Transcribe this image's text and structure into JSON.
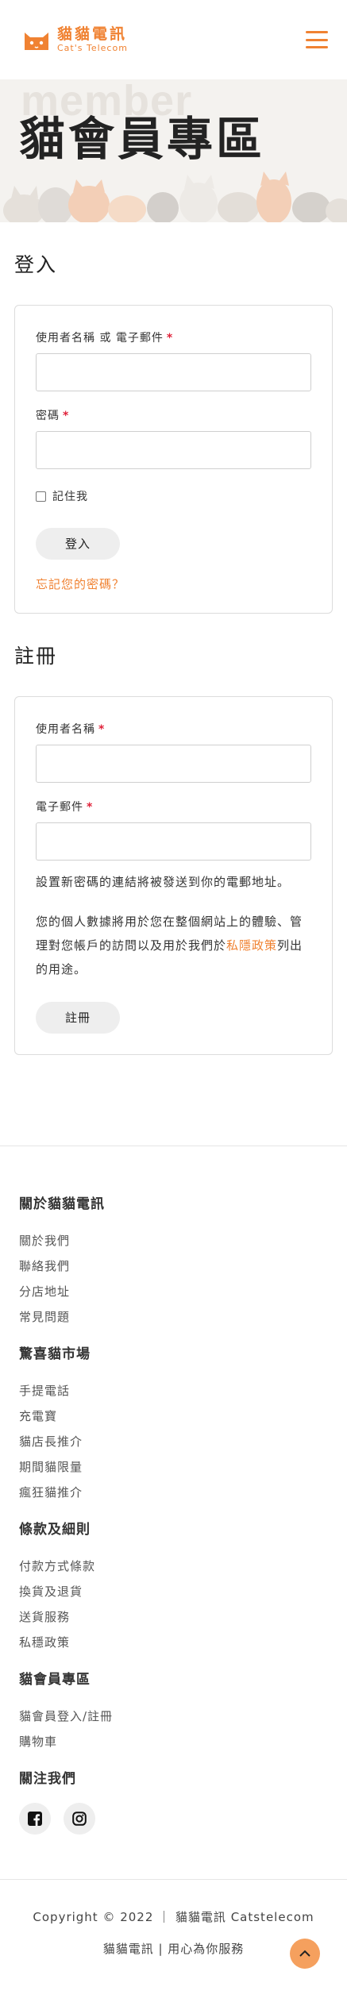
{
  "header": {
    "logo_cn": "貓貓電訊",
    "logo_en": "Cat's Telecom"
  },
  "hero": {
    "subtitle": "member",
    "title": "貓會員專區"
  },
  "login": {
    "heading": "登入",
    "username_label": "使用者名稱 或 電子郵件",
    "password_label": "密碼",
    "required_mark": "*",
    "remember_label": "記住我",
    "submit_label": "登入",
    "forgot_link": "忘記您的密碼？"
  },
  "register": {
    "heading": "註冊",
    "username_label": "使用者名稱",
    "email_label": "電子郵件",
    "required_mark": "*",
    "password_note": "設置新密碼的連結將被發送到你的電郵地址。",
    "privacy_before": "您的個人數據將用於您在整個網站上的體驗、管理對您帳戶的訪問以及用於我們於",
    "privacy_link": "私隱政策",
    "privacy_after": "列出的用途。",
    "submit_label": "註冊"
  },
  "footer": {
    "groups": [
      {
        "heading": "關於貓貓電訊",
        "items": [
          "關於我們",
          "聯絡我們",
          "分店地址",
          "常見問題"
        ]
      },
      {
        "heading": "驚喜貓市場",
        "items": [
          "手提電話",
          "充電寶",
          "貓店長推介",
          "期間貓限量",
          "瘋狂貓推介"
        ]
      },
      {
        "heading": "條款及細則",
        "items": [
          "付款方式條款",
          "換貨及退貨",
          "送貨服務",
          "私穩政策"
        ]
      },
      {
        "heading": "貓會員專區",
        "items": [
          "貓會員登入/註冊",
          "購物車"
        ]
      }
    ],
    "follow_heading": "關注我們",
    "social_icons": [
      "facebook-icon",
      "instagram-icon"
    ],
    "copyright": "Copyright © 2022 ｜ 貓貓電訊 Catstelecom",
    "slogan": "貓貓電訊 | 用心為你服務"
  },
  "colors": {
    "accent": "#f08232",
    "required": "#e0223a",
    "hero_bg": "#f4f2ef",
    "button_bg": "#eeeeee",
    "to_top_bg": "#f5a05e"
  }
}
